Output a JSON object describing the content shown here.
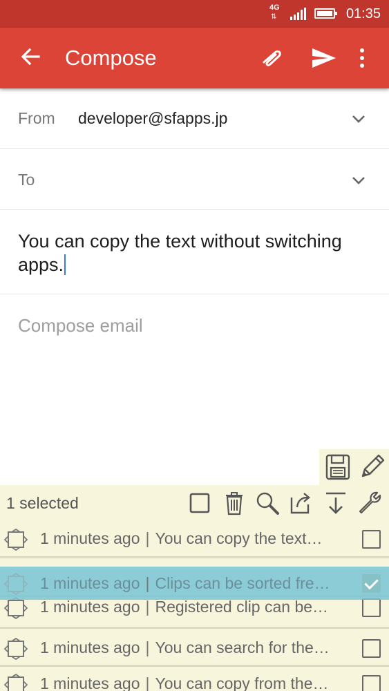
{
  "status_bar": {
    "network": "4G",
    "time": "01:35"
  },
  "app_bar": {
    "title": "Compose"
  },
  "compose": {
    "from_label": "From",
    "from_value": "developer@sfapps.jp",
    "to_label": "To",
    "subject_text": "You can copy the text without switching apps.",
    "body_placeholder": "Compose email"
  },
  "clip_panel": {
    "selected_text": "1 selected",
    "items": [
      {
        "time": "1 minutes ago",
        "separator": "|",
        "text": "You can copy the text…",
        "checked": false
      },
      {
        "time": "1 minutes ago",
        "separator": "|",
        "text": "Clips can be sorted fre…",
        "checked": true
      },
      {
        "time": "1 minutes ago",
        "separator": "|",
        "text": "Registered clip can be…",
        "checked": false
      },
      {
        "time": "1 minutes ago",
        "separator": "|",
        "text": "You can search for the…",
        "checked": false
      },
      {
        "time": "1 minutes ago",
        "separator": "|",
        "text": "You can copy from the…",
        "checked": false
      }
    ]
  },
  "colors": {
    "status_bar": "#c0362c",
    "app_bar": "#db4437",
    "panel": "#f7f5dc",
    "drag_highlight": "#78c4d6"
  }
}
